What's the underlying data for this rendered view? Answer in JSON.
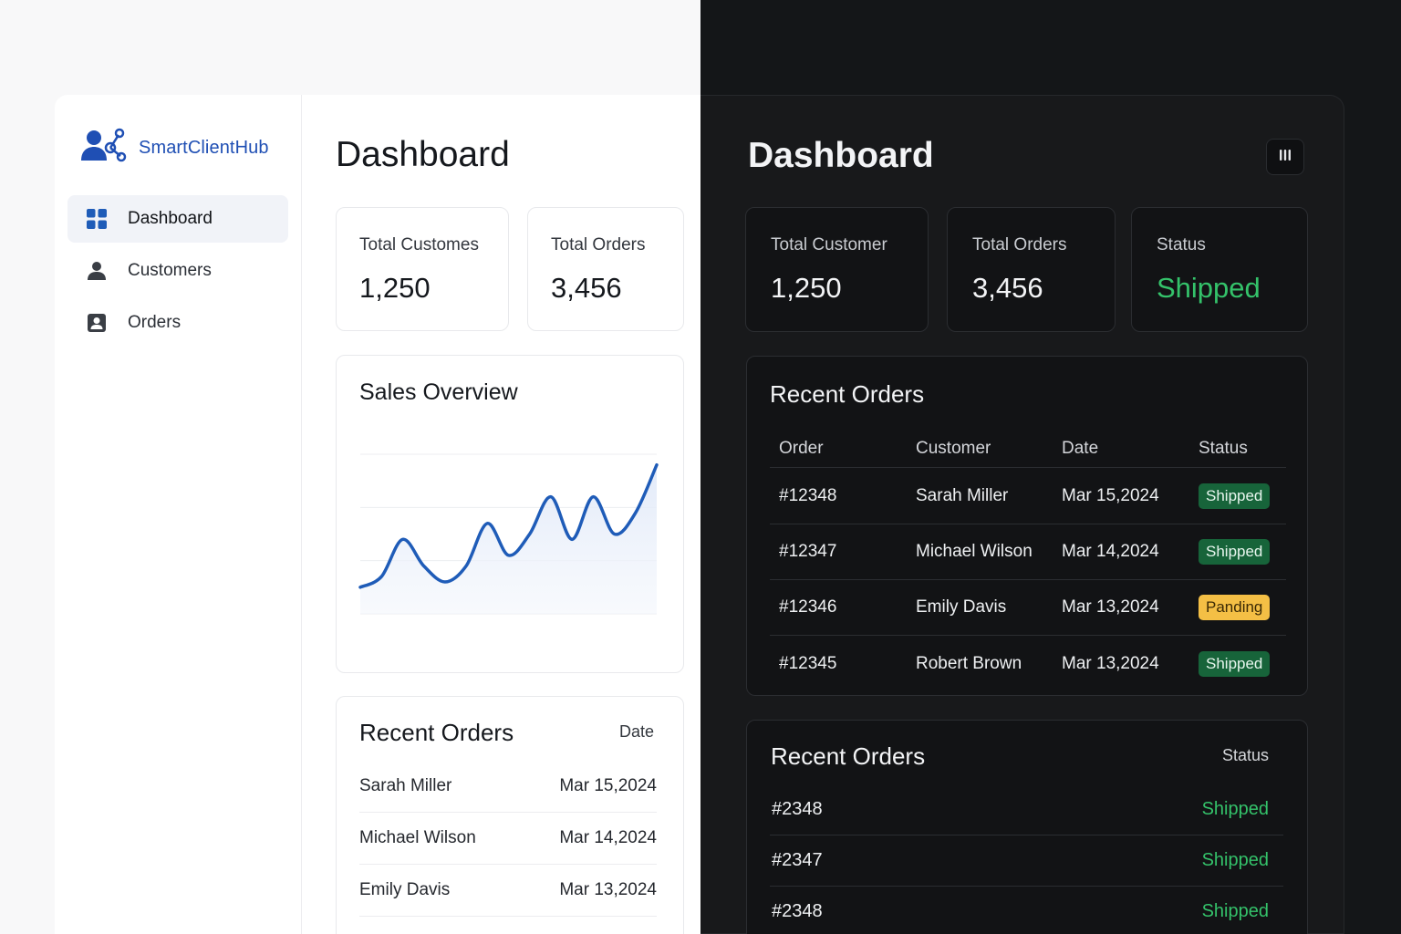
{
  "colors": {
    "accent": "#1f4fb4",
    "chart_line": "#1f5cb8",
    "success": "#34c26a",
    "badge_shipped": "#17643a",
    "badge_pending": "#f4bf45",
    "dark_bg": "#141618"
  },
  "light": {
    "brand": {
      "name": "SmartClientHub",
      "icon": "users-network-icon"
    },
    "nav": [
      {
        "label": "Dashboard",
        "icon": "grid-icon",
        "active": true
      },
      {
        "label": "Customers",
        "icon": "user-icon",
        "active": false
      },
      {
        "label": "Orders",
        "icon": "clipboard-icon",
        "active": false
      }
    ],
    "title": "Dashboard",
    "stats": [
      {
        "label": "Total Customes",
        "value": "1,250"
      },
      {
        "label": "Total Orders",
        "value": "3,456"
      }
    ],
    "sales": {
      "title": "Sales Overview"
    },
    "recent": {
      "title": "Recent Orders",
      "date_header": "Date",
      "rows": [
        {
          "name": "Sarah Miller",
          "date": "Mar 15,2024"
        },
        {
          "name": "Michael Wilson",
          "date": "Mar 14,2024"
        },
        {
          "name": "Emily Davis",
          "date": "Mar 13,2024"
        }
      ]
    }
  },
  "chart_data": {
    "type": "line",
    "title": "Sales Overview",
    "xlabel": "",
    "ylabel": "",
    "grid": true,
    "series": [
      {
        "values": [
          5,
          7,
          14,
          9,
          6,
          9,
          17,
          11,
          15,
          22,
          14,
          22,
          15,
          19,
          28
        ]
      }
    ],
    "ylim": [
      0,
      30
    ]
  },
  "dark": {
    "title": "Dashboard",
    "menu_icon": "bars-icon",
    "stats": [
      {
        "label": "Total Customer",
        "value": "1,250"
      },
      {
        "label": "Total Orders",
        "value": "3,456"
      },
      {
        "label": "Status",
        "value": "Shipped"
      }
    ],
    "table": {
      "title": "Recent Orders",
      "headers": {
        "order": "Order",
        "customer": "Customer",
        "date": "Date",
        "status": "Status"
      },
      "rows": [
        {
          "order": "#12348",
          "customer": "Sarah Miller",
          "date": "Mar 15,2024",
          "status": "Shipped"
        },
        {
          "order": "#12347",
          "customer": "Michael Wilson",
          "date": "Mar 14,2024",
          "status": "Shipped"
        },
        {
          "order": "#12346",
          "customer": "Emily Davis",
          "date": "Mar 13,2024",
          "status": "Panding"
        },
        {
          "order": "#12345",
          "customer": "Robert Brown",
          "date": "Mar 13,2024",
          "status": "Shipped"
        }
      ]
    },
    "recent2": {
      "title": "Recent Orders",
      "status_header": "Status",
      "rows": [
        {
          "order": "#2348",
          "status": "Shipped"
        },
        {
          "order": "#2347",
          "status": "Shipped"
        },
        {
          "order": "#2348",
          "status": "Shipped"
        }
      ]
    }
  }
}
